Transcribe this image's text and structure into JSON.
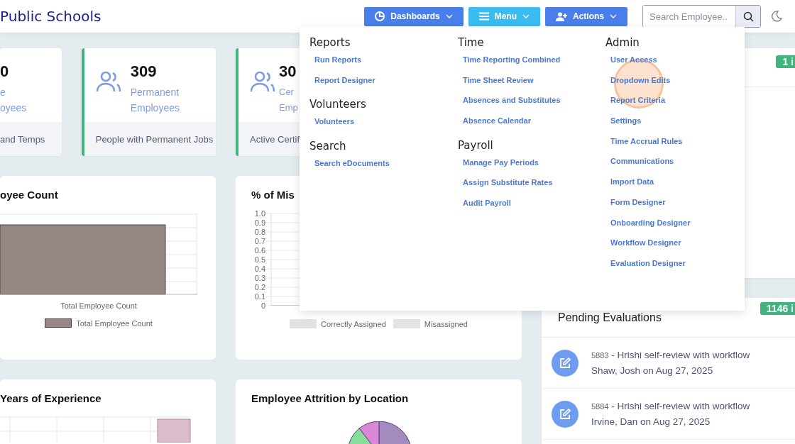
{
  "header": {
    "title": "Public Schools",
    "buttons": [
      {
        "label": "Dashboards",
        "kind": "dashboards"
      },
      {
        "label": "Menu",
        "kind": "menu"
      },
      {
        "label": "Actions",
        "kind": "actions"
      }
    ],
    "search": {
      "placeholder": "Search Employee.."
    }
  },
  "stat_cards": [
    {
      "value": "0",
      "label_lines": [
        "e",
        "oyees"
      ],
      "footer": "and Temps",
      "accent": false
    },
    {
      "value": "309",
      "label_lines": [
        "Permanent",
        "Employees"
      ],
      "footer": "People with Permanent Jobs",
      "accent": true
    },
    {
      "value": "30",
      "label_lines": [
        "Cer",
        "Emp"
      ],
      "footer": "Active Certif",
      "accent": true
    }
  ],
  "charts": [
    {
      "title": "oyee Count",
      "kind": "single_bar",
      "x_label": "Total Employee Count",
      "legend": [
        {
          "label": "Total Employee Count",
          "color": "#968784"
        }
      ]
    },
    {
      "title": "% of Mis",
      "kind": "ticks",
      "y_axis_labels": [
        "1.0",
        "0.9",
        "0.8",
        "0.7",
        "0.6",
        "0.5",
        "0.4",
        "0.3",
        "0.2",
        "0.1",
        "0"
      ],
      "legend": [
        {
          "label": "Correctly Assigned",
          "color": "#e2e2e2"
        },
        {
          "label": "Misassigned",
          "color": "#e3e3e3"
        }
      ]
    },
    {
      "title": "Years of Experience",
      "kind": "grid_bars"
    },
    {
      "title": "Employee Attrition by Location",
      "kind": "pie"
    }
  ],
  "side_panels": [
    {
      "badge": "1 i"
    },
    {
      "title": "Pending Evaluations",
      "badge": "1146 i",
      "items": [
        {
          "number": "5883",
          "title": "- Hrishi self-review with workflow",
          "byline": "Shaw, Josh on Aug 27, 2025"
        },
        {
          "number": "5884",
          "title": "- Hrishi self-review with workflow",
          "byline": "Irvine, Dan on Aug 27, 2025"
        }
      ]
    }
  ],
  "menu": {
    "columns": [
      {
        "sections": [
          {
            "heading": "Reports",
            "links": [
              "Run Reports",
              "Report Designer"
            ]
          },
          {
            "heading": "Volunteers",
            "links": [
              "Volunteers"
            ]
          },
          {
            "heading": "Search",
            "links": [
              "Search eDocuments"
            ]
          }
        ]
      },
      {
        "sections": [
          {
            "heading": "Time",
            "links": [
              "Time Reporting Combined",
              "Time Sheet Review",
              "Absences and Substitutes",
              "Absence Calendar"
            ]
          },
          {
            "heading": "Payroll",
            "links": [
              "Manage Pay Periods",
              "Assign Substitute Rates",
              "Audit Payroll"
            ]
          }
        ]
      },
      {
        "sections": [
          {
            "heading": "Admin",
            "links": [
              "User Access",
              "Dropdown Edits",
              "Report Criteria",
              "Settings",
              "Time Accrual Rules",
              "Communications",
              "Import Data",
              "Form Designer",
              "Onboarding Designer",
              "Workflow Designer",
              "Evaluation Designer"
            ]
          }
        ]
      }
    ]
  }
}
